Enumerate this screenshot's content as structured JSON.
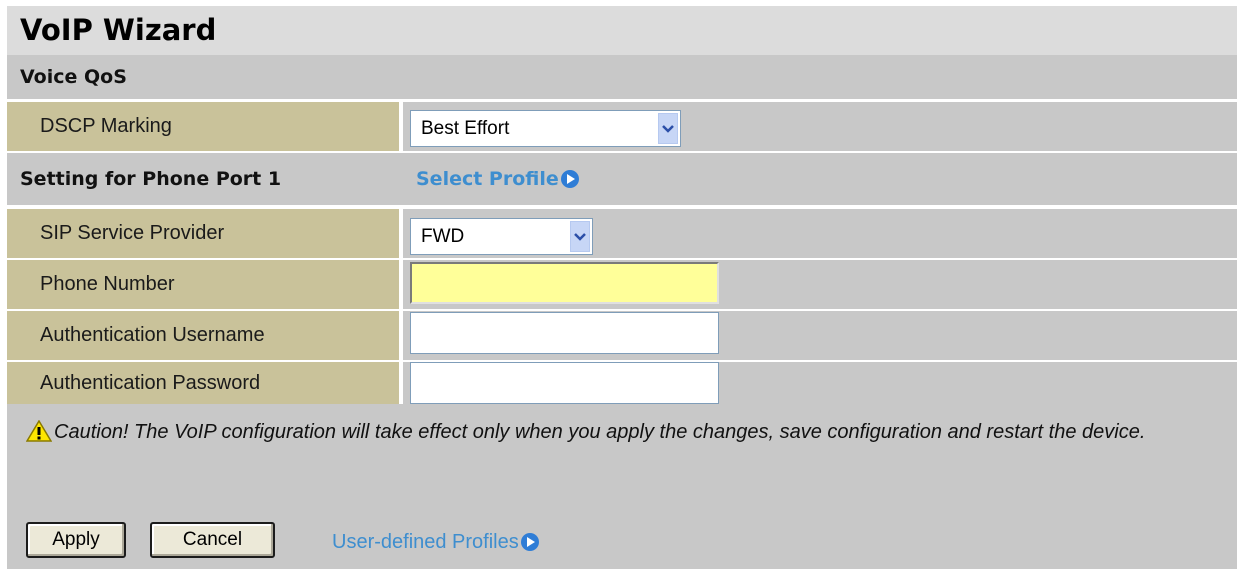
{
  "title": "VoIP Wizard",
  "voice_qos": {
    "heading": "Voice QoS",
    "dscp_label": "DSCP Marking",
    "dscp_value": "Best Effort"
  },
  "phone_port": {
    "heading": "Setting for Phone Port 1",
    "select_profile_link": "Select Profile",
    "link_icon": "play-circle-icon"
  },
  "fields": {
    "sip_provider_label": "SIP Service Provider",
    "sip_provider_value": "FWD",
    "phone_number_label": "Phone Number",
    "phone_number_value": "",
    "auth_username_label": "Authentication Username",
    "auth_username_value": "",
    "auth_password_label": "Authentication Password",
    "auth_password_value": ""
  },
  "caution": {
    "icon": "warning-icon",
    "text": "Caution! The VoIP configuration will take effect only when you apply the changes, save configuration and restart the device."
  },
  "actions": {
    "apply_label": "Apply",
    "cancel_label": "Cancel",
    "user_profiles_link": "User-defined Profiles"
  },
  "colors": {
    "label_bg": "#c9c29a",
    "section_bg": "#c8c8c8",
    "link": "#3e8ecf",
    "highlight_input": "#ffff99"
  }
}
